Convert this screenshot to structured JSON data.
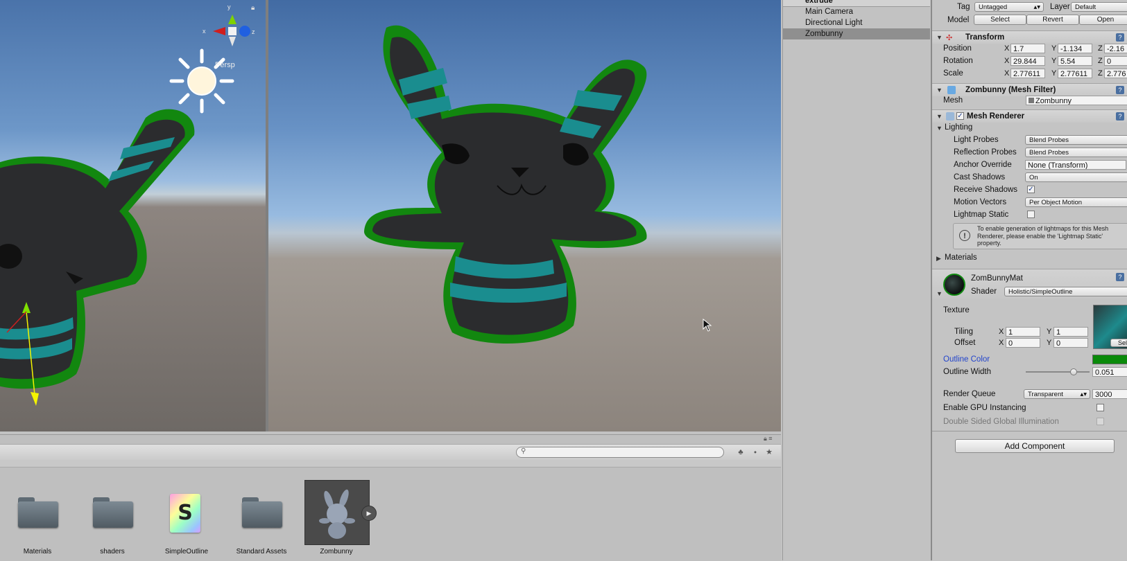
{
  "project": {
    "assets": [
      {
        "name": "Materials",
        "kind": "folder-icon"
      },
      {
        "name": "shaders",
        "kind": "folder-icon"
      },
      {
        "name": "SimpleOutline",
        "kind": "shader-icon"
      },
      {
        "name": "Standard Assets",
        "kind": "folder-icon"
      },
      {
        "name": "Zombunny",
        "kind": "model-icon"
      }
    ]
  },
  "hierarchy": {
    "scene": "extrude",
    "items": [
      "Main Camera",
      "Directional Light",
      "Zombunny"
    ]
  },
  "scene": {
    "persp_label": "Persp",
    "gizmo_axes": {
      "y": "y",
      "x": "x",
      "z": "z"
    }
  },
  "inspector": {
    "tag_label": "Tag",
    "tag_value": "Untagged",
    "layer_label": "Layer",
    "layer_value": "Default",
    "model_label": "Model",
    "model_buttons": [
      "Select",
      "Revert",
      "Open"
    ],
    "transform": {
      "title": "Transform",
      "rows": [
        {
          "label": "Position",
          "x": "1.7",
          "y": "-1.134",
          "z": "-2.16"
        },
        {
          "label": "Rotation",
          "x": "29.844",
          "y": "5.54",
          "z": "0"
        },
        {
          "label": "Scale",
          "x": "2.77611",
          "y": "2.77611",
          "z": "2.776"
        }
      ]
    },
    "mesh_filter": {
      "title": "Zombunny (Mesh Filter)",
      "mesh_label": "Mesh",
      "mesh_value": "Zombunny"
    },
    "mesh_renderer": {
      "title": "Mesh Renderer",
      "lighting_label": "Lighting",
      "light_probes_label": "Light Probes",
      "light_probes_value": "Blend Probes",
      "reflection_probes_label": "Reflection Probes",
      "reflection_probes_value": "Blend Probes",
      "anchor_override_label": "Anchor Override",
      "anchor_override_value": "None (Transform)",
      "cast_shadows_label": "Cast Shadows",
      "cast_shadows_value": "On",
      "receive_shadows_label": "Receive Shadows",
      "receive_shadows_checked": true,
      "motion_vectors_label": "Motion Vectors",
      "motion_vectors_value": "Per Object Motion",
      "lightmap_static_label": "Lightmap Static",
      "lightmap_static_checked": false,
      "info_line1": "To enable generation of lightmaps for this Mesh",
      "info_line2": "Renderer, please enable the 'Lightmap Static'",
      "info_line3": "property.",
      "materials_label": "Materials"
    },
    "material": {
      "name": "ZomBunnyMat",
      "shader_label": "Shader",
      "shader_value": "Holistic/SimpleOutline",
      "texture_label": "Texture",
      "tiling_label": "Tiling",
      "tiling_x": "1",
      "tiling_y": "1",
      "offset_label": "Offset",
      "offset_x": "0",
      "offset_y": "0",
      "select_label": "Sele",
      "outline_color_label": "Outline Color",
      "outline_color": "#0a8a0a",
      "outline_width_label": "Outline Width",
      "outline_width_value": "0.051",
      "outline_width_fraction": 0.78,
      "render_queue_label": "Render Queue",
      "render_queue_mode": "Transparent",
      "render_queue_value": "3000",
      "gpu_instancing_label": "Enable GPU Instancing",
      "double_sided_gi_label": "Double Sided Global Illumination"
    },
    "add_component_label": "Add Component"
  },
  "colors": {
    "outline": "#12870f",
    "bunny_body": "#2b2c2e",
    "stripe": "#1a8d8f",
    "selection": "#8f8f8f"
  }
}
